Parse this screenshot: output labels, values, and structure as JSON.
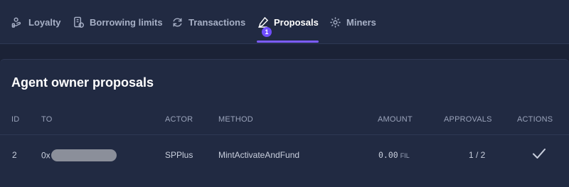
{
  "tabs": [
    {
      "label": "Loyalty",
      "icon": "loyalty-icon"
    },
    {
      "label": "Borrowing limits",
      "icon": "borrowing-limits-icon"
    },
    {
      "label": "Transactions",
      "icon": "transactions-icon"
    },
    {
      "label": "Proposals",
      "icon": "proposals-icon",
      "badge": "1",
      "active": true
    },
    {
      "label": "Miners",
      "icon": "miners-icon"
    }
  ],
  "card": {
    "title": "Agent owner proposals",
    "columns": [
      "ID",
      "TO",
      "ACTOR",
      "METHOD",
      "AMOUNT",
      "APPROVALS",
      "ACTIONS"
    ],
    "rows": [
      {
        "id": "2",
        "to_prefix": "0x",
        "actor": "SPPlus",
        "method": "MintActivateAndFund",
        "amount": "0.00",
        "amount_unit": "FIL",
        "approvals": "1 / 2",
        "action_icon": "checkmark-icon"
      }
    ]
  },
  "colors": {
    "background": "#1b2236",
    "panel": "#212a42",
    "accent": "#7c5cff"
  }
}
